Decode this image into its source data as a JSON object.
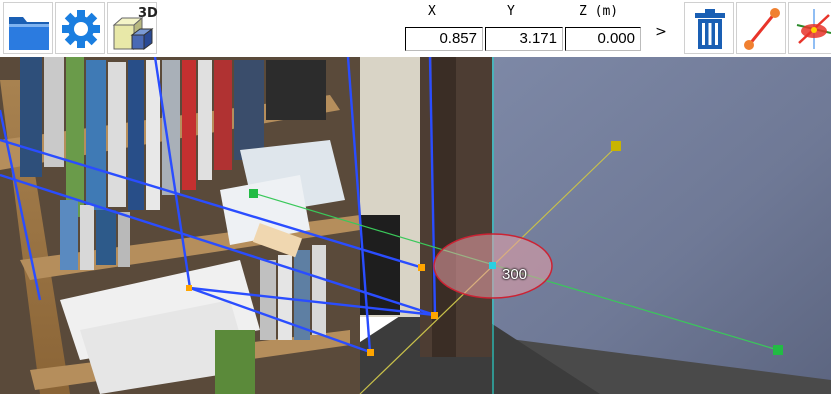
{
  "toolbar": {
    "buttons": [
      {
        "name": "folder-button",
        "icon": "folder-icon"
      },
      {
        "name": "settings-button",
        "icon": "gear-icon"
      },
      {
        "name": "3d-view-button",
        "icon": "3d-box-icon",
        "icon_text": "3D"
      },
      {
        "name": "delete-button",
        "icon": "trash-icon"
      },
      {
        "name": "measure-line-button",
        "icon": "line-tool-icon"
      },
      {
        "name": "plane-tool-button",
        "icon": "plane-tool-icon"
      }
    ],
    "coords": {
      "x_label": "X",
      "y_label": "Y",
      "z_label": "Z (m)",
      "x_value": "0.857",
      "y_value": "3.171",
      "z_value": "0.000"
    },
    "next_label": ">"
  },
  "viewport": {
    "distance_label": "300"
  },
  "colors": {
    "icon_blue": "#1a5fb4",
    "grid_line": "#2a4dff",
    "marker_orange": "#ffa500",
    "marker_green": "#22bb44",
    "marker_yellow": "#c8b400",
    "ellipse_red": "#cc2233"
  }
}
